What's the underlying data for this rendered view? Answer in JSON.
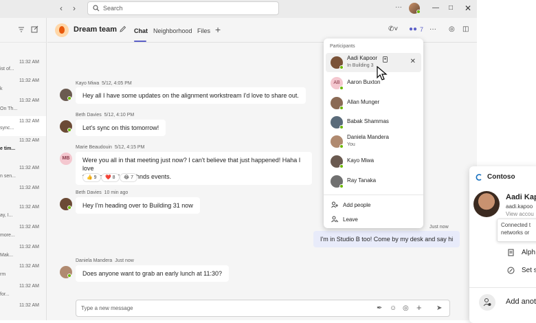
{
  "titlebar": {
    "search_placeholder": "Search",
    "more": "···"
  },
  "leftlist": {
    "items": [
      {
        "time": "11:32 AM",
        "snippet": ""
      },
      {
        "time": "11:32 AM",
        "snippet": "ist of..."
      },
      {
        "time": "11:32 AM",
        "snippet": "k"
      },
      {
        "time": "11:32 AM",
        "snippet": "On Th..."
      },
      {
        "time": "11:32 AM",
        "snippet": "sync..."
      },
      {
        "time": "11:32 AM",
        "snippet": "e tim...",
        "bold": true
      },
      {
        "time": "11:32 AM",
        "snippet": ""
      },
      {
        "time": "11:32 AM",
        "snippet": "n sen..."
      },
      {
        "time": "11:32 AM",
        "snippet": ""
      },
      {
        "time": "11:32 AM",
        "snippet": "ay, I..."
      },
      {
        "time": "11:32 AM",
        "snippet": "more..."
      },
      {
        "time": "11:32 AM",
        "snippet": "Mak..."
      },
      {
        "time": "11:32 AM",
        "snippet": "rm"
      },
      {
        "time": "11:32 AM",
        "snippet": "for..."
      }
    ]
  },
  "chat": {
    "title": "Dream team",
    "tabs": [
      "Chat",
      "Neighborhood",
      "Files"
    ],
    "participant_count": "7",
    "messages": [
      {
        "author": "Kayo Miwa",
        "time": "5/12, 4:05 PM",
        "text": "Hey all I have some updates on the alignment workstream I'd love to share out."
      },
      {
        "author": "Beth Davies",
        "time": "5/12, 4:10 PM",
        "text": "Let's sync on this tomorrow!"
      },
      {
        "author": "Marie Beaudouin",
        "time": "5/12, 4:15 PM",
        "text_line1": "Were you all in that meeting just now? I can't believe that just happened! Haha I love",
        "text_line2": "these org-wide all ahnds events.",
        "initials": "MB",
        "reactions": [
          {
            "emoji": "👍",
            "count": "9"
          },
          {
            "emoji": "❤️",
            "count": "8"
          },
          {
            "emoji": "😂",
            "count": "7"
          }
        ]
      },
      {
        "author": "Beth Davies",
        "time": "10 min ago",
        "text": "Hey I'm heading over to Building 31 now"
      },
      {
        "author": "",
        "time": "Just now",
        "text": "I'm in Studio B too! Come by my desk and say hi",
        "mine": true
      },
      {
        "author": "Daniela Mandera",
        "time": "Just now",
        "text": "Does anyone want to grab an early lunch at 11:30?"
      }
    ],
    "compose_placeholder": "Type a new message"
  },
  "participants": {
    "title": "Participants",
    "people": [
      {
        "name": "Aadi Kapoor",
        "sub": "In Building 3",
        "color": "#7a5238"
      },
      {
        "name": "Aaron Buxton",
        "sub": "",
        "initials": "AB",
        "color": "#f4c7cf"
      },
      {
        "name": "Allan Munger",
        "sub": "",
        "color": "#8a6a55"
      },
      {
        "name": "Babak Shammas",
        "sub": "",
        "color": "#5a6b7a"
      },
      {
        "name": "Daniela Mandera",
        "sub": "You",
        "color": "#b08a70"
      },
      {
        "name": "Kayo Miwa",
        "sub": "",
        "color": "#6a5a50"
      },
      {
        "name": "Ray Tanaka",
        "sub": "",
        "color": "#707070"
      }
    ],
    "add_people": "Add people",
    "leave": "Leave"
  },
  "card": {
    "org": "Contoso",
    "name": "Aadi Kap",
    "email": "aadi.kapoo",
    "view": "View accou",
    "tooltip_line1": "Connected t",
    "tooltip_line2": "networks or",
    "actions": [
      "Alph",
      "Set s"
    ],
    "add_label": "Add anot"
  },
  "colors": {
    "accent": "#5b5fc7",
    "presence": "#6bb700"
  }
}
